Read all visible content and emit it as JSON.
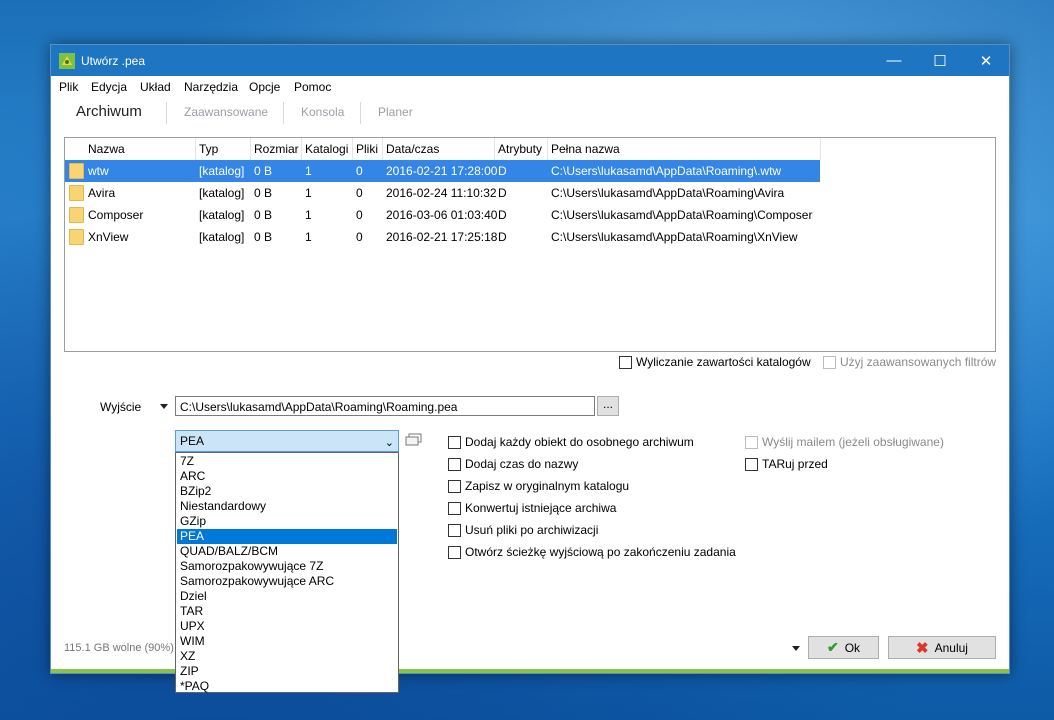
{
  "window": {
    "title": "Utwórz .pea",
    "controls": {
      "minimize": "—",
      "maximize": "☐",
      "close": "✕"
    }
  },
  "menu": [
    "Plik",
    "Edycja",
    "Układ",
    "Narzędzia",
    "Opcje",
    "Pomoc"
  ],
  "tabs": [
    "Archiwum",
    "Zaawansowane",
    "Konsola",
    "Planer"
  ],
  "file_list": {
    "columns": [
      "Nazwa",
      "Typ",
      "Rozmiar",
      "Katalogi",
      "Pliki",
      "Data/czas",
      "Atrybuty",
      "Pełna nazwa"
    ],
    "rows": [
      [
        "wtw",
        "[katalog]",
        "0 B",
        "1",
        "0",
        "2016-02-21 17:28:00",
        "D",
        "C:\\Users\\lukasamd\\AppData\\Roaming\\.wtw"
      ],
      [
        "Avira",
        "[katalog]",
        "0 B",
        "1",
        "0",
        "2016-02-24 11:10:32",
        "D",
        "C:\\Users\\lukasamd\\AppData\\Roaming\\Avira"
      ],
      [
        "Composer",
        "[katalog]",
        "0 B",
        "1",
        "0",
        "2016-03-06 01:03:40",
        "D",
        "C:\\Users\\lukasamd\\AppData\\Roaming\\Composer"
      ],
      [
        "XnView",
        "[katalog]",
        "0 B",
        "1",
        "0",
        "2016-02-21 17:25:18",
        "D",
        "C:\\Users\\lukasamd\\AppData\\Roaming\\XnView"
      ]
    ],
    "selected_row": 0
  },
  "list_options": {
    "count_contents": "Wyliczanie zawartości katalogów",
    "advanced_filters": "Użyj zaawansowanych filtrów"
  },
  "output": {
    "label": "Wyjście",
    "path": "C:\\Users\\lukasamd\\AppData\\Roaming\\Roaming.pea",
    "browse": "..."
  },
  "format": {
    "selected": "PEA",
    "options": [
      "7Z",
      "ARC",
      "BZip2",
      "Niestandardowy",
      "GZip",
      "PEA",
      "QUAD/BALZ/BCM",
      "Samorozpakowywujące 7Z",
      "Samorozpakowywujące ARC",
      "Dziel",
      "TAR",
      "UPX",
      "WIM",
      "XZ",
      "ZIP",
      "*PAQ"
    ],
    "selected_index": 5
  },
  "options": [
    "Dodaj każdy obiekt do osobnego archiwum",
    "Dodaj czas do nazwy",
    "Zapisz w oryginalnym katalogu",
    "Konwertuj istniejące archiwa",
    "Usuń pliki po archiwizacji",
    "Otwórz ścieżkę wyjściową po zakończeniu zadania"
  ],
  "options_right": {
    "send_mail": "Wyślij mailem (jeżeli obsługiwane)",
    "tar_before": "TARuj przed"
  },
  "status": {
    "free_space": "115.1 GB wolne (90%)"
  },
  "buttons": {
    "ok": "Ok",
    "cancel": "Anuluj"
  },
  "colors": {
    "titlebar": "#1e75c2",
    "selection": "#3385e6",
    "accent_bar": "#8bc34a",
    "ok_check": "#2e9b2e",
    "cancel_x": "#d9372b"
  }
}
